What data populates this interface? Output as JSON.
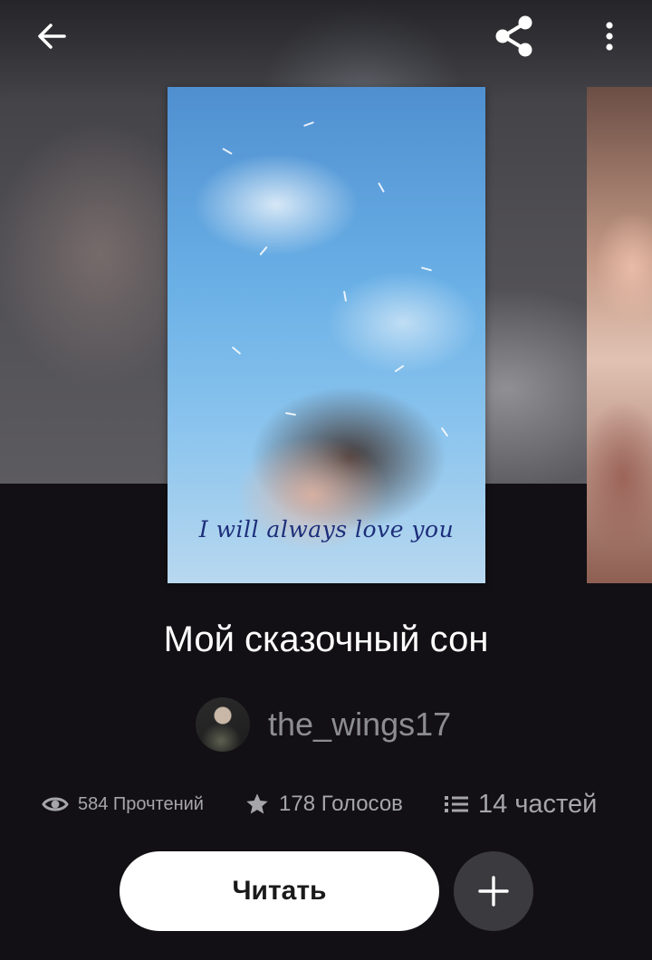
{
  "topbar": {
    "back_icon": "arrow-left-icon",
    "share_icon": "share-icon",
    "more_icon": "more-vertical-icon"
  },
  "cover": {
    "caption": "I will always love you"
  },
  "story": {
    "title": "Мой сказочный сон",
    "author": "the_wings17"
  },
  "stats": {
    "reads": "584 Прочтений",
    "votes": "178 Голосов",
    "parts": "14 частей"
  },
  "actions": {
    "read_label": "Читать",
    "add_icon": "plus-icon"
  },
  "colors": {
    "background": "#121014",
    "title": "#ffffff",
    "muted_text": "#a6a6aa",
    "read_button": "#ffffff",
    "add_button": "#3b3a3e"
  }
}
